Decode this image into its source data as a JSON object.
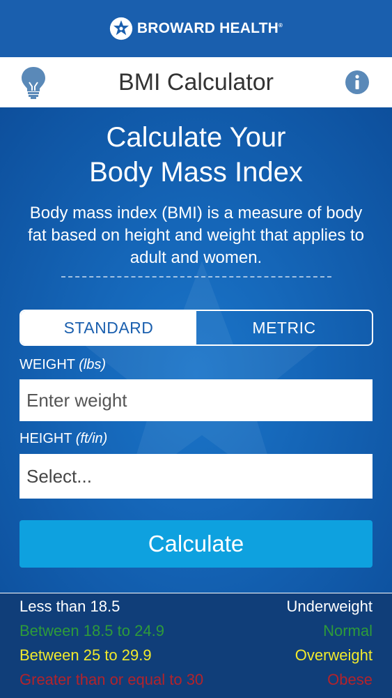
{
  "brand": {
    "name": "BROWARD HEALTH",
    "tm": "®"
  },
  "header": {
    "title": "BMI Calculator"
  },
  "main": {
    "headline_line1": "Calculate Your",
    "headline_line2": "Body Mass Index",
    "description": "Body mass index (BMI) is a measure of body fat based on height and weight that applies to adult and women."
  },
  "units": {
    "standard": "STANDARD",
    "metric": "METRIC",
    "selected": "STANDARD"
  },
  "weight": {
    "label": "WEIGHT",
    "unit": "(lbs)",
    "placeholder": "Enter weight",
    "value": ""
  },
  "height": {
    "label": "HEIGHT",
    "unit": "(ft/in)",
    "value": "Select..."
  },
  "calculate_label": "Calculate",
  "legend": [
    {
      "range": "Less than 18.5",
      "category": "Underweight",
      "color": "#ffffff"
    },
    {
      "range": "Between 18.5 to 24.9",
      "category": "Normal",
      "color": "#2e9b3a"
    },
    {
      "range": "Between 25 to 29.9",
      "category": "Overweight",
      "color": "#f2ea2c"
    },
    {
      "range": "Greater than or equal to 30",
      "category": "Obese",
      "color": "#b3232b"
    }
  ],
  "colors": {
    "primary": "#1a5fae",
    "button": "#0ea1df",
    "legend_bg": "#103e79"
  }
}
